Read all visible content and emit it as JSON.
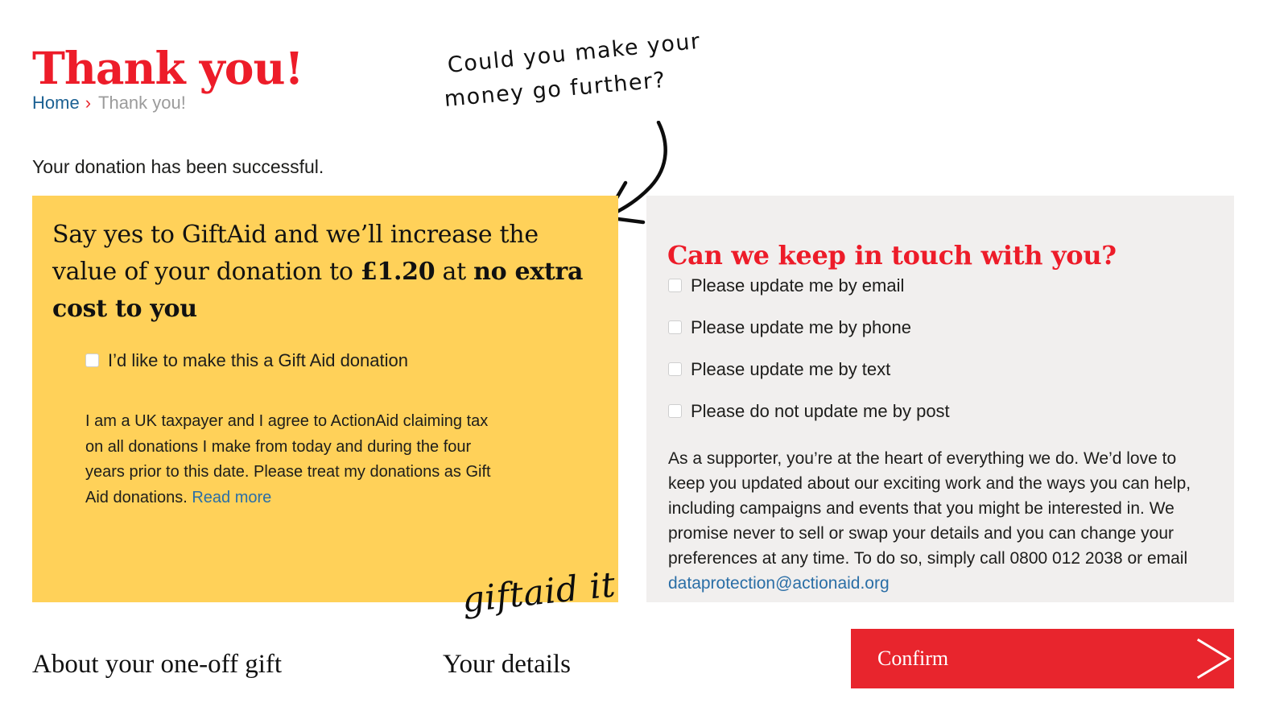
{
  "page": {
    "title": "Thank you!",
    "intro": "Your donation has been successful."
  },
  "breadcrumb": {
    "home_label": "Home",
    "separator": "›",
    "current_label": "Thank you!"
  },
  "annotation": {
    "line1": "Could you make your",
    "line2": "money go further?",
    "arrow_icon": "curved-arrow-icon"
  },
  "giftaid": {
    "heading_part1": "Say yes to GiftAid and we’ll increase the value of your donation to ",
    "heading_amount": "£1.20",
    "heading_part2": " at ",
    "heading_emphasis": "no extra cost to you",
    "checkbox_label": "I’d like to make this a Gift Aid donation",
    "checkbox_checked": false,
    "declaration": "I am a UK taxpayer and I agree to ActionAid claiming tax on all donations I make from today and during the four years prior to this date. Please treat my donations as Gift Aid donations. ",
    "read_more_label": "Read more",
    "logo_text": "giftaid it",
    "background_color": "#FFD159"
  },
  "keep_in_touch": {
    "heading": "Can we keep in touch with you?",
    "options": [
      {
        "label": "Please update me by email",
        "checked": false
      },
      {
        "label": "Please update me by phone",
        "checked": false
      },
      {
        "label": "Please update me by text",
        "checked": false
      },
      {
        "label": "Please do not update me by post",
        "checked": false
      }
    ],
    "body_text": "As a supporter, you’re at the heart of everything we do. We’d love to keep you updated about our exciting work and the ways you can help, including campaigns and events that you might be interested in. We promise never to sell or swap your details and you can change your preferences at any time. To do so, simply call 0800 012 2038 or email ",
    "phone_number": "0800 012 2038",
    "email": "dataprotection@actionaid.org",
    "background_color": "#F1EFEE"
  },
  "footer": {
    "link_about": "About your one-off gift",
    "link_details": "Your details",
    "confirm_label": "Confirm",
    "confirm_icon": "chevron-right-icon",
    "confirm_color": "#E8252D"
  },
  "colors": {
    "brand_red": "#ED1C29",
    "link_blue": "#1C6193",
    "muted_grey": "#9B9B9B",
    "text": "#1D1D1B"
  }
}
